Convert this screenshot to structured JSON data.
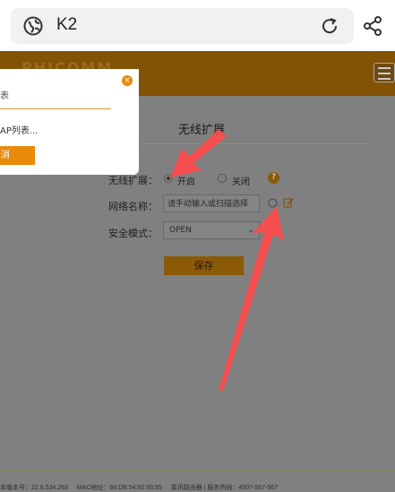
{
  "browser": {
    "url_text": "K2",
    "icons": [
      "globe-icon",
      "reload-icon",
      "share-icon"
    ]
  },
  "router": {
    "brand_partial": "PHICOMM",
    "heading": "无线扩展",
    "fields": {
      "wireless_label": "无线扩展：",
      "radio_on": "开启",
      "radio_off": "关闭",
      "help": "?",
      "network_label": "网络名称：",
      "network_placeholder": "请手动输入或扫描选择",
      "security_label": "安全模式：",
      "security_value": "OPEN"
    },
    "save_label": "保存",
    "footer": {
      "version": "本版本号：22.6.534.263",
      "mac": "MAC地址：68:DB:54:82:93:95",
      "company": "斐讯路由器 | 服务热线：4007-567-567"
    }
  },
  "modal": {
    "title_partial": "表",
    "message_partial": "AP列表...",
    "button_partial": "消",
    "close": "×"
  },
  "colors": {
    "header_brown": "#825205",
    "accent_orange": "#e88a0c",
    "annotation_red": "#ff4b4b"
  }
}
